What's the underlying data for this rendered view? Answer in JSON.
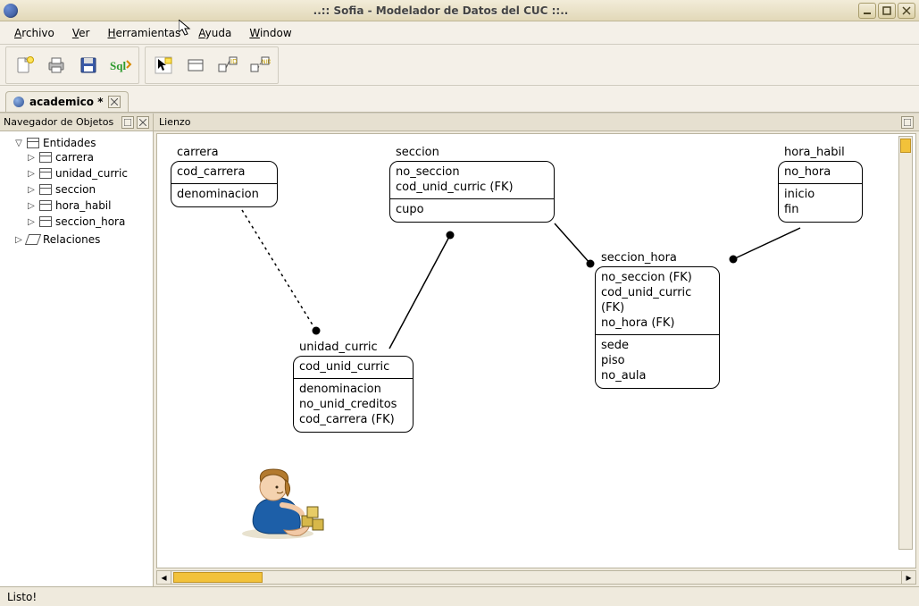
{
  "window": {
    "title": "..:: Sofia - Modelador de Datos del CUC ::.."
  },
  "menu": {
    "archivo": "Archivo",
    "ver": "Ver",
    "herramientas": "Herramientas",
    "ayuda": "Ayuda",
    "window": "Window"
  },
  "toolbar": {
    "new": "new-document",
    "print": "print",
    "save": "save",
    "sql": "sql",
    "pointer": "pointer",
    "entity": "entity-tool",
    "ident_rel": "identifying-relationship-tool",
    "nonident_rel": "nonidentifying-relationship-tool"
  },
  "tabs": {
    "active": "academico *"
  },
  "navigator": {
    "title": "Navegador de Objetos",
    "root_entities": "Entidades",
    "root_relations": "Relaciones",
    "entities": [
      "carrera",
      "unidad_curric",
      "seccion",
      "hora_habil",
      "seccion_hora"
    ]
  },
  "canvas": {
    "title": "Lienzo",
    "entities": {
      "carrera": {
        "name": "carrera",
        "pk": [
          "cod_carrera"
        ],
        "attrs": [
          "denominacion"
        ]
      },
      "seccion": {
        "name": "seccion",
        "pk": [
          "no_seccion",
          "cod_unid_curric (FK)"
        ],
        "attrs": [
          "cupo"
        ]
      },
      "hora_habil": {
        "name": "hora_habil",
        "pk": [
          "no_hora"
        ],
        "attrs": [
          "inicio",
          "fin"
        ]
      },
      "unidad_curric": {
        "name": "unidad_curric",
        "pk": [
          "cod_unid_curric"
        ],
        "attrs": [
          "denominacion",
          "no_unid_creditos",
          "cod_carrera (FK)"
        ]
      },
      "seccion_hora": {
        "name": "seccion_hora",
        "pk": [
          "no_seccion (FK)",
          "cod_unid_curric (FK)",
          "no_hora (FK)"
        ],
        "attrs": [
          "sede",
          "piso",
          "no_aula"
        ]
      }
    }
  },
  "status": {
    "text": "Listo!"
  },
  "chart_data": {
    "type": "erd",
    "entities": [
      {
        "name": "carrera",
        "pk": [
          "cod_carrera"
        ],
        "attrs": [
          "denominacion"
        ]
      },
      {
        "name": "unidad_curric",
        "pk": [
          "cod_unid_curric"
        ],
        "attrs": [
          "denominacion",
          "no_unid_creditos",
          "cod_carrera (FK)"
        ]
      },
      {
        "name": "seccion",
        "pk": [
          "no_seccion",
          "cod_unid_curric (FK)"
        ],
        "attrs": [
          "cupo"
        ]
      },
      {
        "name": "hora_habil",
        "pk": [
          "no_hora"
        ],
        "attrs": [
          "inicio",
          "fin"
        ]
      },
      {
        "name": "seccion_hora",
        "pk": [
          "no_seccion (FK)",
          "cod_unid_curric (FK)",
          "no_hora (FK)"
        ],
        "attrs": [
          "sede",
          "piso",
          "no_aula"
        ]
      }
    ],
    "relationships": [
      {
        "from": "carrera",
        "to": "unidad_curric",
        "identifying": false
      },
      {
        "from": "unidad_curric",
        "to": "seccion",
        "identifying": true
      },
      {
        "from": "seccion",
        "to": "seccion_hora",
        "identifying": true
      },
      {
        "from": "hora_habil",
        "to": "seccion_hora",
        "identifying": true
      }
    ]
  }
}
